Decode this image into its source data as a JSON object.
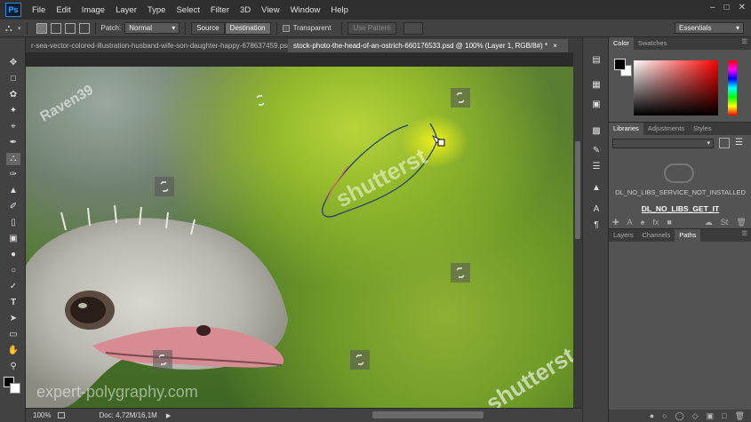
{
  "app": {
    "logo": "Ps"
  },
  "menu": [
    "File",
    "Edit",
    "Image",
    "Layer",
    "Type",
    "Select",
    "Filter",
    "3D",
    "View",
    "Window",
    "Help"
  ],
  "options": {
    "patch_label": "Patch:",
    "patch_value": "Normal",
    "source": "Source",
    "destination": "Destination",
    "transparent": "Transparent",
    "use_pattern": "Use Pattern",
    "workspace": "Essentials"
  },
  "tabs": [
    {
      "label": "r-sea-vector-colored-illustration-husband-wife-son-daughter-happy-678637459.psd",
      "active": false
    },
    {
      "label": "stock-photo-the-head-of-an-ostrich-660176533.psd @ 100% (Layer 1, RGB/8#) *",
      "active": true
    }
  ],
  "canvas": {
    "watermarks": [
      "Raven39",
      "shutterst",
      "expert-polygraphy.com",
      "shutterst"
    ]
  },
  "status": {
    "zoom": "100%",
    "doc": "Doc: 4,72M/16,1M"
  },
  "color_panel": {
    "tabs": [
      "Color",
      "Swatches"
    ]
  },
  "libraries_panel": {
    "tabs": [
      "Libraries",
      "Adjustments",
      "Styles"
    ],
    "message": "DL_NO_LIBS_SERVICE_NOT_INSTALLED",
    "link": "DL_NO_LIBS_GET_IT"
  },
  "layers_panel": {
    "tabs": [
      "Layers",
      "Channels",
      "Paths"
    ],
    "active": "Paths"
  },
  "colors": {
    "fg": "#000000",
    "bg": "#ffffff",
    "selection_stroke": "#2b3e6e"
  }
}
